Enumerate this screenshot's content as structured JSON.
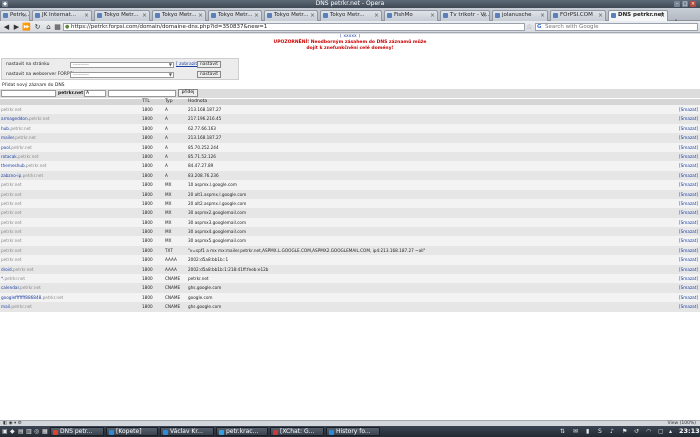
{
  "window": {
    "title": "DNS petrkr.net - Opera"
  },
  "tabs": [
    {
      "label": "Petrk...",
      "active": false
    },
    {
      "label": "JK Internat...",
      "active": false
    },
    {
      "label": "Tokyo Metr...",
      "active": false
    },
    {
      "label": "Tokyo Metr...",
      "active": false
    },
    {
      "label": "Tokyo Metr...",
      "active": false
    },
    {
      "label": "Tokyo Metr...",
      "active": false
    },
    {
      "label": "Tokyo Metr...",
      "active": false
    },
    {
      "label": "FishMo",
      "active": false
    },
    {
      "label": "Tv trikotr - Vi...",
      "active": false
    },
    {
      "label": "jolanusche",
      "active": false
    },
    {
      "label": "FOrPSI.COM",
      "active": false
    },
    {
      "label": "DNS petrkr.net",
      "active": true
    }
  ],
  "address": {
    "url": "https://petrkr.forpsi.com/domain/domaine-dns.php?id=350837&new=1"
  },
  "search": {
    "placeholder": "Search with Google"
  },
  "page": {
    "pager": "[ xxxxx ]",
    "error_line1": "UPOZORNĚNÍ! Neodborným zásahem do DNS záznamů může",
    "error_line2": "dojít k znefunkčnění celé domény!",
    "form": {
      "row1_label": "nastavit na stránku",
      "row1_select": "-----------",
      "row1_link": "[ zobrazit ]",
      "row1_button": "nastavit",
      "row2_label": "nastavit na webserver FORPSI",
      "row2_select": "-----------",
      "row2_button": "nastavit"
    },
    "add_label": "Přidat nový záznam do DNS",
    "add_zone": "petrkr.net",
    "add_type": "A",
    "add_button": "přidej",
    "headers": {
      "ttl": "TTL",
      "typ": "Typ",
      "value": "Hodnota"
    },
    "rows": [
      {
        "host": "",
        "suffix": "petrkr.net",
        "ttl": "1800",
        "type": "A",
        "value": "213.168.187.27",
        "action": "[Smazat]"
      },
      {
        "host": "armageddon.",
        "suffix": "petrkr.net",
        "ttl": "1800",
        "type": "A",
        "value": "217.196.216.45",
        "action": "[Smazat]"
      },
      {
        "host": "hub.",
        "suffix": "petrkr.net",
        "ttl": "1800",
        "type": "A",
        "value": "62.77.66.163",
        "action": "[Smazat]"
      },
      {
        "host": "mailer.",
        "suffix": "petrkr.net",
        "ttl": "1800",
        "type": "A",
        "value": "213.168.187.27",
        "action": "[Smazat]"
      },
      {
        "host": "pool.",
        "suffix": "petrkr.net",
        "ttl": "1800",
        "type": "A",
        "value": "85.70.252.244",
        "action": "[Smazat]"
      },
      {
        "host": "rotacak.",
        "suffix": "petrkr.net",
        "ttl": "1800",
        "type": "A",
        "value": "85.71.52.126",
        "action": "[Smazat]"
      },
      {
        "host": "themeshub.",
        "suffix": "petrkr.net",
        "ttl": "1800",
        "type": "A",
        "value": "84.47.27.89",
        "action": "[Smazat]"
      },
      {
        "host": "zabzno-ip.",
        "suffix": "petrkr.net",
        "ttl": "1800",
        "type": "A",
        "value": "83.208.76.236",
        "action": "[Smazat]"
      },
      {
        "host": "",
        "suffix": "petrkr.net",
        "ttl": "1800",
        "type": "MX",
        "value": "10 aspmx.l.google.com",
        "action": "[Smazat]"
      },
      {
        "host": "",
        "suffix": "petrkr.net",
        "ttl": "1800",
        "type": "MX",
        "value": "20 alt1.aspmx.l.google.com",
        "action": "[Smazat]"
      },
      {
        "host": "",
        "suffix": "petrkr.net",
        "ttl": "1800",
        "type": "MX",
        "value": "20 alt2.aspmx.l.google.com",
        "action": "[Smazat]"
      },
      {
        "host": "",
        "suffix": "petrkr.net",
        "ttl": "1800",
        "type": "MX",
        "value": "30 aspmx2.googlemail.com",
        "action": "[Smazat]"
      },
      {
        "host": "",
        "suffix": "petrkr.net",
        "ttl": "1800",
        "type": "MX",
        "value": "30 aspmx3.googlemail.com",
        "action": "[Smazat]"
      },
      {
        "host": "",
        "suffix": "petrkr.net",
        "ttl": "1800",
        "type": "MX",
        "value": "30 aspmx4.googlemail.com",
        "action": "[Smazat]"
      },
      {
        "host": "",
        "suffix": "petrkr.net",
        "ttl": "1800",
        "type": "MX",
        "value": "30 aspmx5.googlemail.com",
        "action": "[Smazat]"
      },
      {
        "host": "",
        "suffix": "petrkr.net",
        "ttl": "1800",
        "type": "TXT",
        "value": "\"v=spf1 a mx mx:mailer.petrkr.net,ASPMX.L.GOOGLE.COM,ASPMX2.GOOGLEMAIL.COM, ip4:213.168.187.27 ~all\"",
        "action": "[Smazat]"
      },
      {
        "host": "",
        "suffix": "petrkr.net",
        "ttl": "1800",
        "type": "AAAA",
        "value": "2002:d5a8:bb1b::1",
        "action": "[Smazat]"
      },
      {
        "host": "droid.",
        "suffix": "petrkr.net",
        "ttl": "1800",
        "type": "AAAA",
        "value": "2002:d5a8:bb1b:1:218:41ff:feeb:e12b",
        "action": "[Smazat]"
      },
      {
        "host": "*.",
        "suffix": "petrkr.net",
        "ttl": "1800",
        "type": "CNAME",
        "value": "petrkr.net",
        "action": "[Smazat]"
      },
      {
        "host": "calendar.",
        "suffix": "petrkr.net",
        "ttl": "1800",
        "type": "CNAME",
        "value": "ghs.google.com",
        "action": "[Smazat]"
      },
      {
        "host": "googlefffffff886848.",
        "suffix": "petrkr.net",
        "ttl": "1800",
        "type": "CNAME",
        "value": "google.com",
        "action": "[Smazat]"
      },
      {
        "host": "mail.",
        "suffix": "petrkr.net",
        "ttl": "1800",
        "type": "CNAME",
        "value": "ghs.google.com",
        "action": "[Smazat]"
      }
    ]
  },
  "statusbar": {
    "zoom": "View (100%)"
  },
  "taskbar": {
    "items": [
      {
        "label": "DNS petr...",
        "color": "#d9442e"
      },
      {
        "label": "[Kopete]",
        "color": "#2d8ad6"
      },
      {
        "label": "Václav Kr...",
        "color": "#2d8ad6"
      },
      {
        "label": "petr.krac...",
        "color": "#36a0e0"
      },
      {
        "label": "[XChat: G...",
        "color": "#c43b3b"
      },
      {
        "label": "History fo...",
        "color": "#2d8ad6"
      }
    ],
    "clock": "23:13"
  },
  "colors": {
    "link": "#1a3fa3",
    "error": "#cc0000"
  }
}
